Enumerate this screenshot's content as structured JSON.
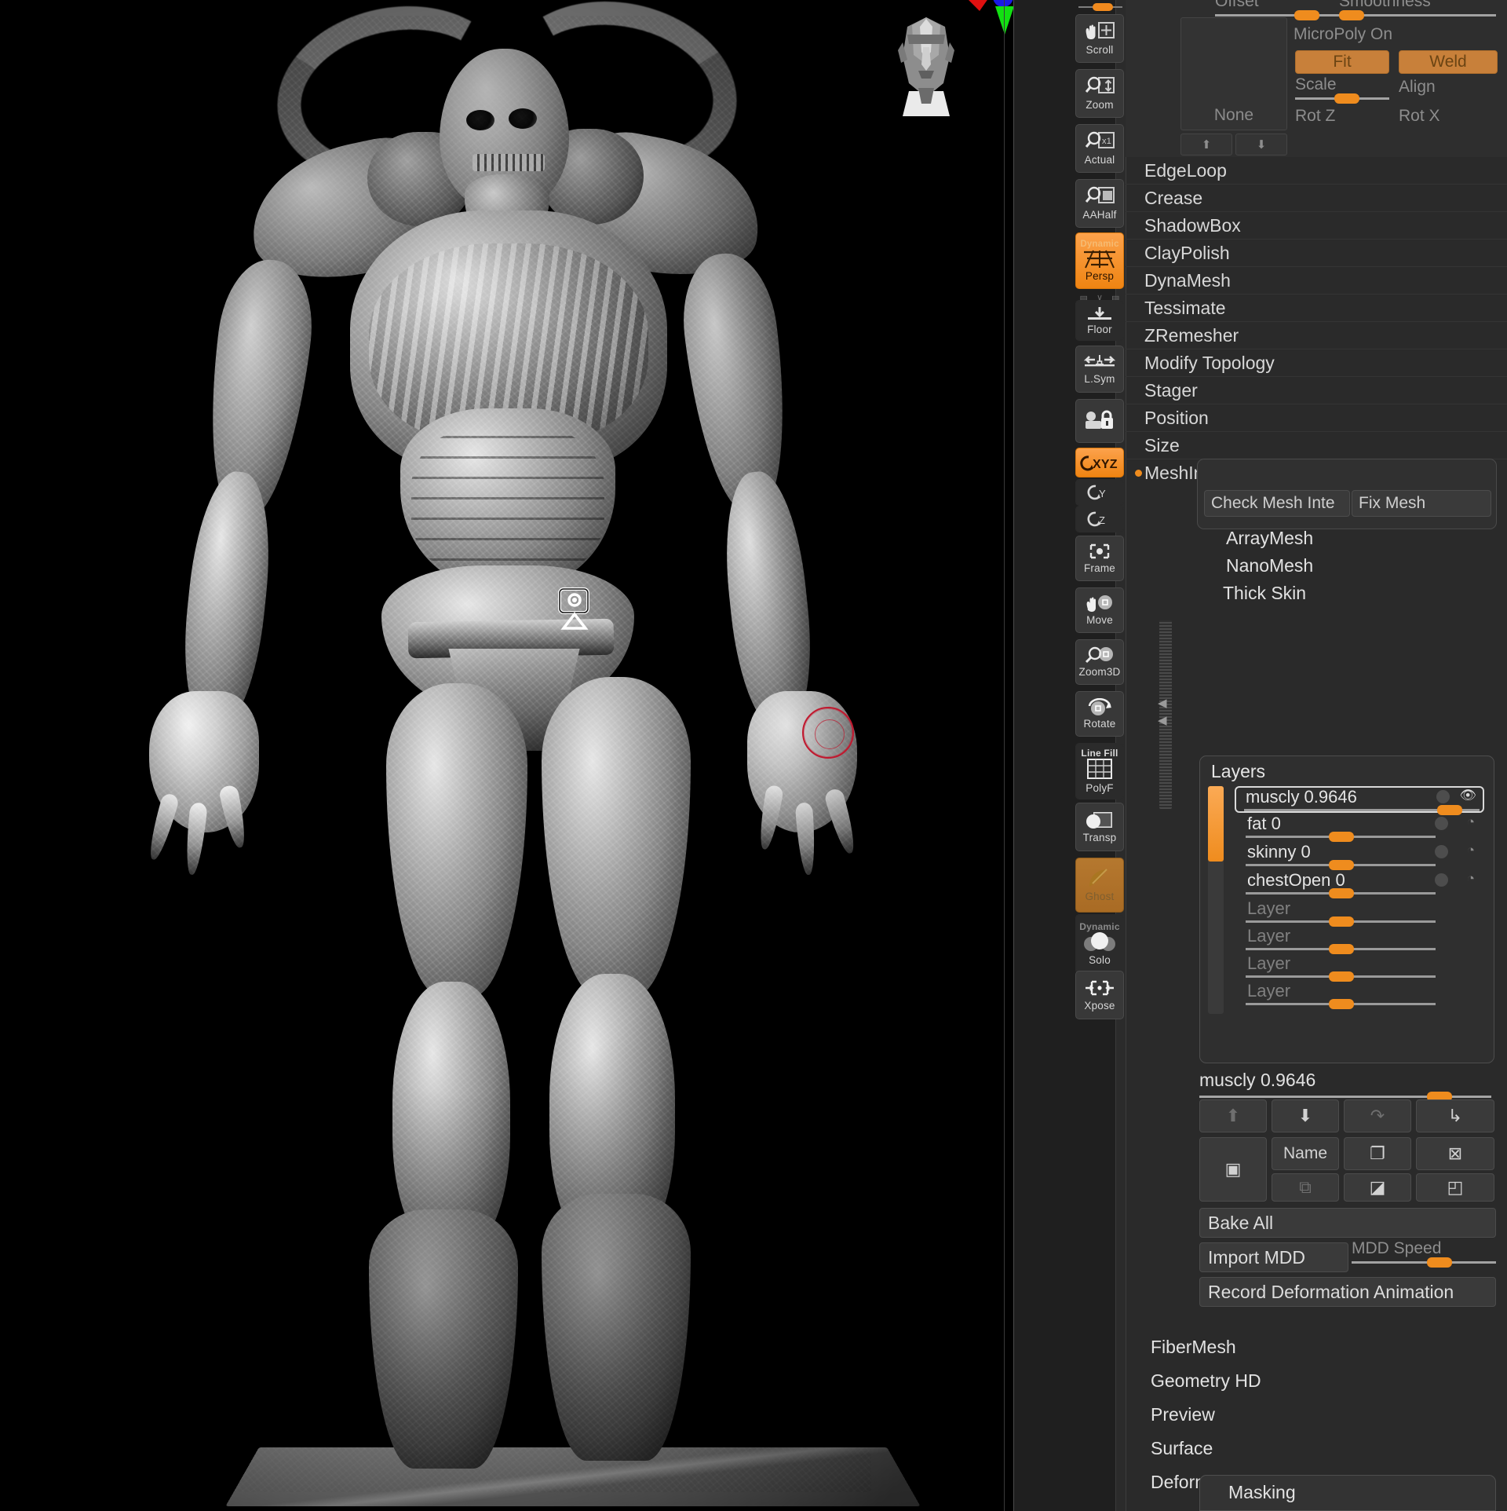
{
  "app": {
    "name": "ZBrush",
    "accent": "#ef8c1e",
    "panel_bg": "#2a2a2a",
    "viewport_bg": "#000000"
  },
  "viewport": {
    "subject": "demon-creature-sculpt",
    "nav_preview": "head-navigation-thumbnail",
    "axis_gizmo": "rgb-axis-gizmo",
    "brush_cursor": "brush-radius-cursor",
    "transform_gizmo": "gizmo-3d-widget",
    "pedestal": "model-pedestal"
  },
  "toolbar": {
    "top_slider": {
      "name": "viewport-slider",
      "value": 0.35
    },
    "buttons": [
      {
        "id": "scroll",
        "label": "Scroll",
        "icon": "hand-move-icon",
        "state": "off"
      },
      {
        "id": "zoom",
        "label": "Zoom",
        "icon": "zoom-vertical-icon",
        "state": "off"
      },
      {
        "id": "actual",
        "label": "Actual",
        "icon": "zoom-1x-icon",
        "state": "off"
      },
      {
        "id": "aahalf",
        "label": "AAHalf",
        "icon": "zoom-half-icon",
        "state": "off"
      },
      {
        "id": "persp",
        "label": "Persp",
        "sub": "Dynamic",
        "icon": "perspective-grid-icon",
        "state": "on"
      },
      {
        "id": "floor",
        "label": "Floor",
        "icon": "floor-grid-icon",
        "state": "off"
      },
      {
        "id": "lsym",
        "label": "L.Sym",
        "icon": "local-symmetry-icon",
        "state": "off"
      },
      {
        "id": "camlock",
        "label": "",
        "icon": "camera-lock-icon",
        "state": "off"
      },
      {
        "id": "rotxyz",
        "label": "XYZ",
        "icon": "rotate-xyz-icon",
        "state": "on"
      },
      {
        "id": "roty",
        "label": "Y",
        "icon": "rotate-y-icon",
        "state": "flat"
      },
      {
        "id": "rotz",
        "label": "Z",
        "icon": "rotate-z-icon",
        "state": "flat"
      },
      {
        "id": "frame",
        "label": "Frame",
        "icon": "frame-icon",
        "state": "off"
      },
      {
        "id": "move",
        "label": "Move",
        "icon": "hand-sphere-icon",
        "state": "off"
      },
      {
        "id": "zoom3d",
        "label": "Zoom3D",
        "icon": "zoom-sphere-icon",
        "state": "off"
      },
      {
        "id": "rotate",
        "label": "Rotate",
        "icon": "rotate-sphere-icon",
        "state": "off"
      },
      {
        "id": "polyf",
        "label": "PolyF",
        "sub": "Line Fill",
        "icon": "polyframe-grid-icon",
        "state": "flat"
      },
      {
        "id": "transp",
        "label": "Transp",
        "icon": "transparency-icon",
        "state": "off"
      },
      {
        "id": "ghost",
        "label": "Ghost",
        "icon": "ghost-icon",
        "state": "on2"
      },
      {
        "id": "solo",
        "label": "Solo",
        "sub": "Dynamic",
        "icon": "solo-spheres-icon",
        "state": "flat"
      },
      {
        "id": "xpose",
        "label": "Xpose",
        "icon": "explode-arrows-icon",
        "state": "off"
      }
    ],
    "mini_icons": [
      "grid-left-icon",
      "axis-tripod-icon",
      "grid-right-icon"
    ]
  },
  "top_panel": {
    "offset": {
      "label": "Offset",
      "value": 0.42
    },
    "smoothness": {
      "label": "Smoothness",
      "value": 0.05
    },
    "preview": {
      "label": "None"
    },
    "microPolyOn": "MicroPoly On",
    "fit": "Fit",
    "weld": "Weld",
    "scale": {
      "label": "Scale",
      "value": 0.46
    },
    "align": "Align",
    "rotZ": "Rot Z",
    "rotX": "Rot X",
    "nav_up": "up-arrow-icon",
    "nav_down": "down-arrow-icon"
  },
  "menu": {
    "items": [
      {
        "label": "EdgeLoop",
        "marker": false
      },
      {
        "label": "Crease",
        "marker": false
      },
      {
        "label": "ShadowBox",
        "marker": false
      },
      {
        "label": "ClayPolish",
        "marker": false
      },
      {
        "label": "DynaMesh",
        "marker": false
      },
      {
        "label": "Tessimate",
        "marker": false
      },
      {
        "label": "ZRemesher",
        "marker": false
      },
      {
        "label": "Modify Topology",
        "marker": false
      },
      {
        "label": "Stager",
        "marker": false
      },
      {
        "label": "Position",
        "marker": false
      },
      {
        "label": "Size",
        "marker": false
      },
      {
        "label": "MeshIntegrity",
        "marker": true
      }
    ],
    "mesh_integrity": {
      "check": "Check Mesh Inte",
      "fix": "Fix Mesh"
    },
    "sub_items": [
      "ArrayMesh",
      "NanoMesh",
      "Thick Skin"
    ]
  },
  "layers": {
    "title": "Layers",
    "scroll_position": 0,
    "rows": [
      {
        "name": "muscly 0.9646",
        "value": 0.9646,
        "slider": 0.82,
        "selected": true,
        "visible": true,
        "rec_icon": "eye-icon"
      },
      {
        "name": "fat 0",
        "value": 0,
        "slider": 0.44,
        "selected": false,
        "visible": false,
        "rec_icon": "record-icon"
      },
      {
        "name": "skinny 0",
        "value": 0,
        "slider": 0.44,
        "selected": false,
        "visible": false,
        "rec_icon": "record-icon"
      },
      {
        "name": "chestOpen 0",
        "value": 0,
        "slider": 0.44,
        "selected": false,
        "visible": false,
        "rec_icon": "record-icon"
      },
      {
        "name": "Layer",
        "value": null,
        "slider": 0.44,
        "selected": false,
        "visible": false,
        "rec_icon": ""
      },
      {
        "name": "Layer",
        "value": null,
        "slider": 0.44,
        "selected": false,
        "visible": false,
        "rec_icon": ""
      },
      {
        "name": "Layer",
        "value": null,
        "slider": 0.44,
        "selected": false,
        "visible": false,
        "rec_icon": ""
      },
      {
        "name": "Layer",
        "value": null,
        "slider": 0.44,
        "selected": false,
        "visible": false,
        "rec_icon": ""
      }
    ],
    "current": {
      "label": "muscly 0.9646",
      "slider": 0.78
    },
    "actions_row1": [
      {
        "name": "move-layer-up",
        "icon": "arrow-up-icon",
        "enabled": false
      },
      {
        "name": "move-layer-down",
        "icon": "arrow-down-icon",
        "enabled": true
      },
      {
        "name": "merge-up",
        "icon": "arrow-turn-right-icon",
        "enabled": false
      },
      {
        "name": "merge-down",
        "icon": "arrow-turn-down-icon",
        "enabled": true
      }
    ],
    "actions_row2": [
      {
        "name": "new-layer",
        "icon": "new-layer-icon",
        "enabled": true
      },
      {
        "name": "rename-layer",
        "label": "Name",
        "enabled": true
      },
      {
        "name": "duplicate-layer",
        "icon": "duplicate-icon",
        "enabled": true
      },
      {
        "name": "delete-layer",
        "icon": "delete-x-icon",
        "enabled": true
      }
    ],
    "actions_row3": [
      {
        "name": "split-layer",
        "icon": "split-icon",
        "enabled": false
      },
      {
        "name": "bake-layer",
        "icon": "bake-icon",
        "enabled": true
      },
      {
        "name": "apply-layer",
        "icon": "apply-icon",
        "enabled": true
      }
    ],
    "bake_all": "Bake All",
    "import_mdd": "Import MDD",
    "mdd_speed": {
      "label": "MDD Speed",
      "value": 0.52
    },
    "record": "Record Deformation Animation"
  },
  "footer": {
    "items": [
      "FiberMesh",
      "Geometry HD",
      "Preview",
      "Surface",
      "Deformation"
    ],
    "masking": "Masking"
  }
}
